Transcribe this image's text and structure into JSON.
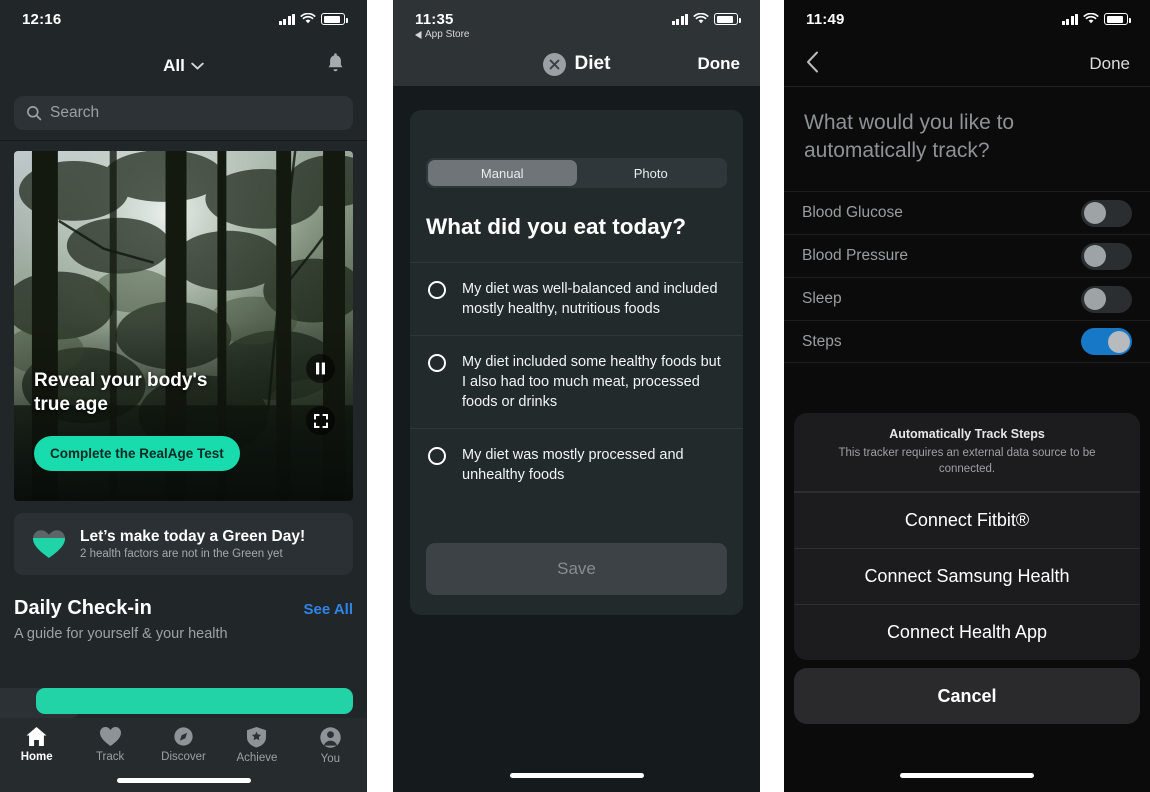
{
  "panel1": {
    "status": {
      "time": "12:16",
      "icons": [
        "signal-icon",
        "wifi-icon",
        "battery-icon"
      ]
    },
    "header": {
      "filter_label": "All",
      "chevron": "chevron-down-icon",
      "bell": "bell-icon"
    },
    "search": {
      "placeholder": "Search",
      "icon": "search-icon"
    },
    "hero": {
      "title_line1": "Reveal your body's",
      "title_line2": "true age",
      "cta_label": "Complete the RealAge Test",
      "pause_icon": "pause-icon",
      "expand_icon": "fullscreen-icon"
    },
    "green_card": {
      "title": "Let’s make today a Green Day!",
      "subtitle": "2 health factors are not in the Green yet",
      "icon": "heart-icon"
    },
    "daily": {
      "title": "Daily Check-in",
      "see_all": "See All",
      "subtitle": "A guide for yourself & your health"
    },
    "tabs": [
      {
        "label": "Home",
        "icon": "home-icon",
        "active": true
      },
      {
        "label": "Track",
        "icon": "heart-icon",
        "active": false
      },
      {
        "label": "Discover",
        "icon": "compass-icon",
        "active": false
      },
      {
        "label": "Achieve",
        "icon": "shield-star-icon",
        "active": false
      },
      {
        "label": "You",
        "icon": "person-icon",
        "active": false
      }
    ],
    "accent_color": "#19dcae"
  },
  "panel2": {
    "status": {
      "time": "11:35",
      "back_app": "App Store"
    },
    "nav": {
      "title": "Diet",
      "close_icon": "close-circle-icon",
      "done_label": "Done"
    },
    "segmented": {
      "options": [
        "Manual",
        "Photo"
      ],
      "selected": "Manual"
    },
    "question": "What did you eat today?",
    "options": [
      "My diet was well-balanced and included mostly healthy, nutritious foods",
      "My diet included some healthy foods but I also had too much meat, processed foods or drinks",
      "My diet was mostly processed and unhealthy foods"
    ],
    "save_label": "Save"
  },
  "panel3": {
    "status": {
      "time": "11:49"
    },
    "nav": {
      "back_icon": "chevron-left-icon",
      "done_label": "Done"
    },
    "question": "What would you like to automatically track?",
    "trackers": [
      {
        "label": "Blood Glucose",
        "on": false
      },
      {
        "label": "Blood Pressure",
        "on": false
      },
      {
        "label": "Sleep",
        "on": false
      },
      {
        "label": "Steps",
        "on": true
      }
    ],
    "action_sheet": {
      "title": "Automatically Track Steps",
      "message": "This tracker requires an external data source to be connected.",
      "actions": [
        "Connect Fitbit®",
        "Connect Samsung Health",
        "Connect Health App"
      ],
      "cancel_label": "Cancel"
    },
    "toggle_on_color": "#1878c8"
  }
}
